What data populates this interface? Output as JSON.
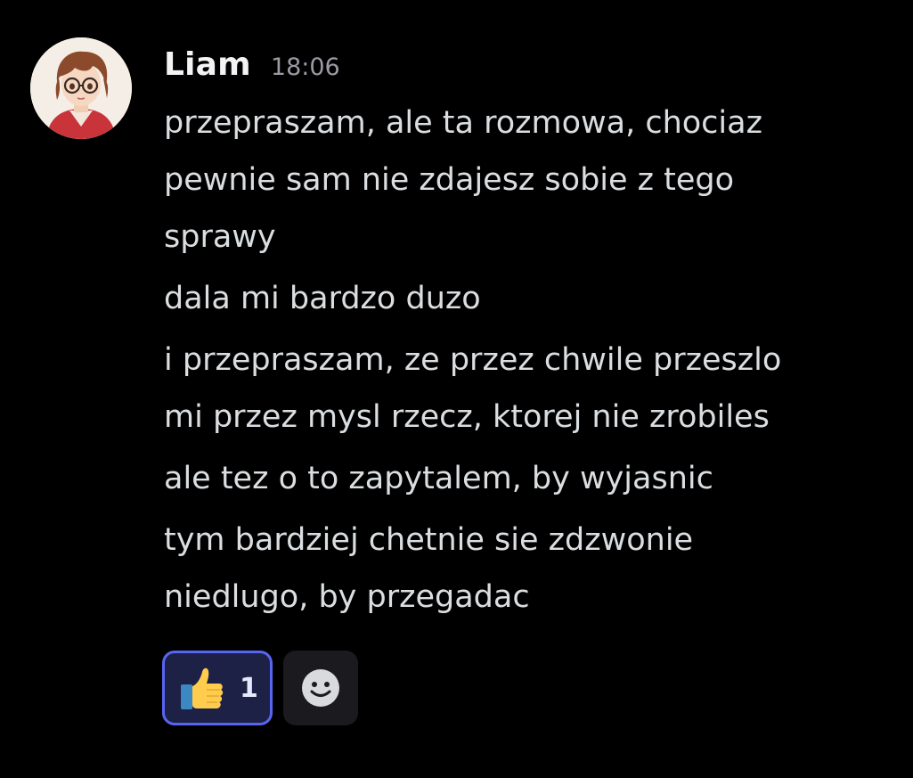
{
  "message": {
    "author": "Liam",
    "timestamp": "18:06",
    "avatar_icon": "anime-boy-with-glasses-avatar",
    "lines": [
      "przepraszam, ale ta rozmowa, chociaz",
      "pewnie sam nie zdajesz sobie z tego",
      "sprawy",
      "dala mi bardzo duzo",
      "i przepraszam, ze przez chwile przeszlo",
      "mi przez mysl rzecz, ktorej nie zrobiles",
      "ale tez o to zapytalem, by wyjasnic",
      "tym bardziej chetnie sie zdzwonie",
      "niedlugo, by przegadac"
    ]
  },
  "reactions": [
    {
      "emoji": "thumbs-up-icon",
      "count": "1",
      "active": true
    }
  ],
  "add_reaction_icon": "smiley-icon",
  "colors": {
    "background": "#000000",
    "text": "#dbdee1",
    "timestamp": "#9a9ba3",
    "reaction_border": "#5865f2",
    "reaction_bg": "#1e2146"
  }
}
